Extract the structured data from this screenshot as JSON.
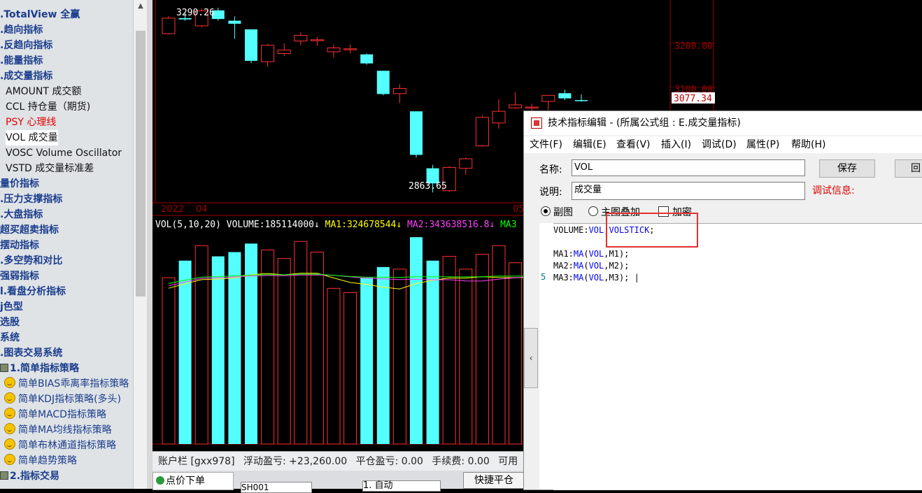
{
  "tree": {
    "items": [
      {
        "label": ".TotalView 全赢",
        "kind": "cat"
      },
      {
        "label": ".趋向指标",
        "kind": "cat"
      },
      {
        "label": ".反趋向指标",
        "kind": "cat"
      },
      {
        "label": ".能量指标",
        "kind": "cat"
      },
      {
        "label": ".成交量指标",
        "kind": "cat"
      },
      {
        "label": "AMOUNT 成交额",
        "kind": "leaf"
      },
      {
        "label": "CCL 持仓量（期货)",
        "kind": "leaf"
      },
      {
        "label": "PSY 心理线",
        "kind": "leaf-red"
      },
      {
        "label": "VOL 成交量",
        "kind": "leaf-sel"
      },
      {
        "label": "VOSC Volume Oscillator",
        "kind": "leaf"
      },
      {
        "label": "VSTD 成交量标准差",
        "kind": "leaf"
      },
      {
        "label": "量价指标",
        "kind": "cat"
      },
      {
        "label": ".压力支撑指标",
        "kind": "cat"
      },
      {
        "label": ".大盘指标",
        "kind": "cat"
      },
      {
        "label": "超买超卖指标",
        "kind": "cat"
      },
      {
        "label": "摆动指标",
        "kind": "cat"
      },
      {
        "label": ".多空势和对比",
        "kind": "cat"
      },
      {
        "label": "强弱指标",
        "kind": "cat"
      },
      {
        "label": "l.看盘分析指标",
        "kind": "cat"
      },
      {
        "label": "j色型",
        "kind": "cat"
      },
      {
        "label": "选股",
        "kind": "cat"
      },
      {
        "label": "系统",
        "kind": "cat"
      },
      {
        "label": ".图表交易系统",
        "kind": "cat"
      },
      {
        "label": "1.简单指标策略",
        "kind": "box"
      },
      {
        "label": "简单BIAS乖离率指标策略",
        "kind": "strat"
      },
      {
        "label": "简单KDJ指标策略(多头)",
        "kind": "strat"
      },
      {
        "label": "简单MACD指标策略",
        "kind": "strat"
      },
      {
        "label": "简单MA均线指标策略",
        "kind": "strat"
      },
      {
        "label": "简单布林通道指标策略",
        "kind": "strat"
      },
      {
        "label": "简单趋势策略",
        "kind": "strat"
      },
      {
        "label": "2.指标交易",
        "kind": "box"
      }
    ]
  },
  "chart": {
    "price_labels": {
      "high": "3290.26",
      "low": "2863.65",
      "last": "3077.34"
    },
    "axis_ticks": [
      "3200.00",
      "3100.00"
    ],
    "date_labels": {
      "year": "2022",
      "month": "04",
      "next": "05"
    },
    "indicator_line": [
      {
        "text": "VOL(5,10,20)",
        "color": "#ffffff"
      },
      {
        "text": "VOLUME:185114000↓",
        "color": "#ffffff"
      },
      {
        "text": "MA1:324678544↓",
        "color": "#ffff00"
      },
      {
        "text": "MA2:343638516.8↓",
        "color": "#ff40ff"
      },
      {
        "text": "MA3",
        "color": "#00ff00"
      }
    ],
    "colors": {
      "up": "#ff3030",
      "down": "#54ffff",
      "grid": "#a00000",
      "ma1": "#ffff00",
      "ma2": "#ff40ff",
      "ma3": "#00ff00"
    }
  },
  "chart_data": {
    "type": "candlestick",
    "candles": [
      {
        "o": 3232,
        "h": 3272,
        "l": 3230,
        "c": 3268
      },
      {
        "o": 3268,
        "h": 3280,
        "l": 3262,
        "c": 3265
      },
      {
        "o": 3250,
        "h": 3290,
        "l": 3248,
        "c": 3285
      },
      {
        "o": 3286,
        "h": 3292,
        "l": 3262,
        "c": 3266
      },
      {
        "o": 3262,
        "h": 3272,
        "l": 3220,
        "c": 3255
      },
      {
        "o": 3242,
        "h": 3242,
        "l": 3164,
        "c": 3169
      },
      {
        "o": 3167,
        "h": 3208,
        "l": 3155,
        "c": 3205
      },
      {
        "o": 3186,
        "h": 3210,
        "l": 3180,
        "c": 3194
      },
      {
        "o": 3215,
        "h": 3235,
        "l": 3205,
        "c": 3228
      },
      {
        "o": 3218,
        "h": 3224,
        "l": 3204,
        "c": 3218
      },
      {
        "o": 3190,
        "h": 3206,
        "l": 3176,
        "c": 3199
      },
      {
        "o": 3197,
        "h": 3207,
        "l": 3186,
        "c": 3197
      },
      {
        "o": 3184,
        "h": 3186,
        "l": 3160,
        "c": 3163
      },
      {
        "o": 3146,
        "h": 3146,
        "l": 3089,
        "c": 3092
      },
      {
        "o": 3093,
        "h": 3115,
        "l": 3071,
        "c": 3105
      },
      {
        "o": 3052,
        "h": 3052,
        "l": 2945,
        "c": 2951
      },
      {
        "o": 2920,
        "h": 2928,
        "l": 2864,
        "c": 2885
      },
      {
        "o": 2868,
        "h": 2925,
        "l": 2865,
        "c": 2922
      },
      {
        "o": 2920,
        "h": 2945,
        "l": 2905,
        "c": 2942
      },
      {
        "o": 2972,
        "h": 3042,
        "l": 2970,
        "c": 3038
      },
      {
        "o": 3025,
        "h": 3080,
        "l": 3012,
        "c": 3052
      },
      {
        "o": 3060,
        "h": 3096,
        "l": 3058,
        "c": 3067
      },
      {
        "o": 3061,
        "h": 3070,
        "l": 3040,
        "c": 3062
      },
      {
        "o": 3075,
        "h": 3085,
        "l": 3055,
        "c": 3089
      },
      {
        "o": 3094,
        "h": 3102,
        "l": 3078,
        "c": 3082
      },
      {
        "o": 3078,
        "h": 3091,
        "l": 3074,
        "c": 3077
      }
    ],
    "volume": [
      0.78,
      0.86,
      0.93,
      0.88,
      0.9,
      0.94,
      0.91,
      0.87,
      0.95,
      0.9,
      0.73,
      0.71,
      0.78,
      0.83,
      0.82,
      0.97,
      0.86,
      0.88,
      0.82,
      0.89,
      0.93,
      0.85,
      0.9,
      0.9,
      0.9,
      0.9
    ],
    "ylim": [
      2840,
      3310
    ]
  },
  "account": {
    "label": "账户栏 [gxx978]",
    "float_pnl": "浮动盈亏: +23,260.00",
    "close_pnl": "平仓盈亏: 0.00",
    "fee": "手续费: 0.00",
    "avail": "可用"
  },
  "order": {
    "tab": "点价下单",
    "code": "SH001",
    "mode": "1. 自动",
    "quick_close": "快捷平仓"
  },
  "dialog": {
    "title": "技术指标编辑 - (所属公式组 : E.成交量指标)",
    "menu": [
      "文件(F)",
      "编辑(E)",
      "查看(V)",
      "插入(I)",
      "调试(D)",
      "属性(P)",
      "帮助(H)"
    ],
    "name_label": "名称:",
    "name_value": "VOL",
    "desc_label": "说明:",
    "desc_value": "成交量",
    "save_button": "保存",
    "extra_button": "回",
    "debug_label": "调试信息:",
    "radio_sub": "副图",
    "radio_main": "主图叠加",
    "encrypt": "加密",
    "code_lines": [
      [
        {
          "t": "VOLUME:",
          "k": 0
        },
        {
          "t": "VOL",
          "k": 1
        },
        {
          "t": ",",
          "k": 0
        },
        {
          "t": "VOLSTICK",
          "k": 1
        },
        {
          "t": ";",
          "k": 0
        }
      ],
      [
        {
          "t": "MA1:",
          "k": 0
        },
        {
          "t": "MA",
          "k": 1
        },
        {
          "t": "(",
          "k": 0
        },
        {
          "t": "VOL",
          "k": 1
        },
        {
          "t": ",M1);",
          "k": 0
        }
      ],
      [
        {
          "t": "MA2:",
          "k": 0
        },
        {
          "t": "MA",
          "k": 1
        },
        {
          "t": "(",
          "k": 0
        },
        {
          "t": "VOL",
          "k": 1
        },
        {
          "t": ",M2);",
          "k": 0
        }
      ],
      [
        {
          "t": "MA3:",
          "k": 0
        },
        {
          "t": "MA",
          "k": 1
        },
        {
          "t": "(",
          "k": 0
        },
        {
          "t": "VOL",
          "k": 1
        },
        {
          "t": ",M3); |",
          "k": 0
        }
      ]
    ],
    "gutter_num": "5",
    "collapse": "‹"
  }
}
